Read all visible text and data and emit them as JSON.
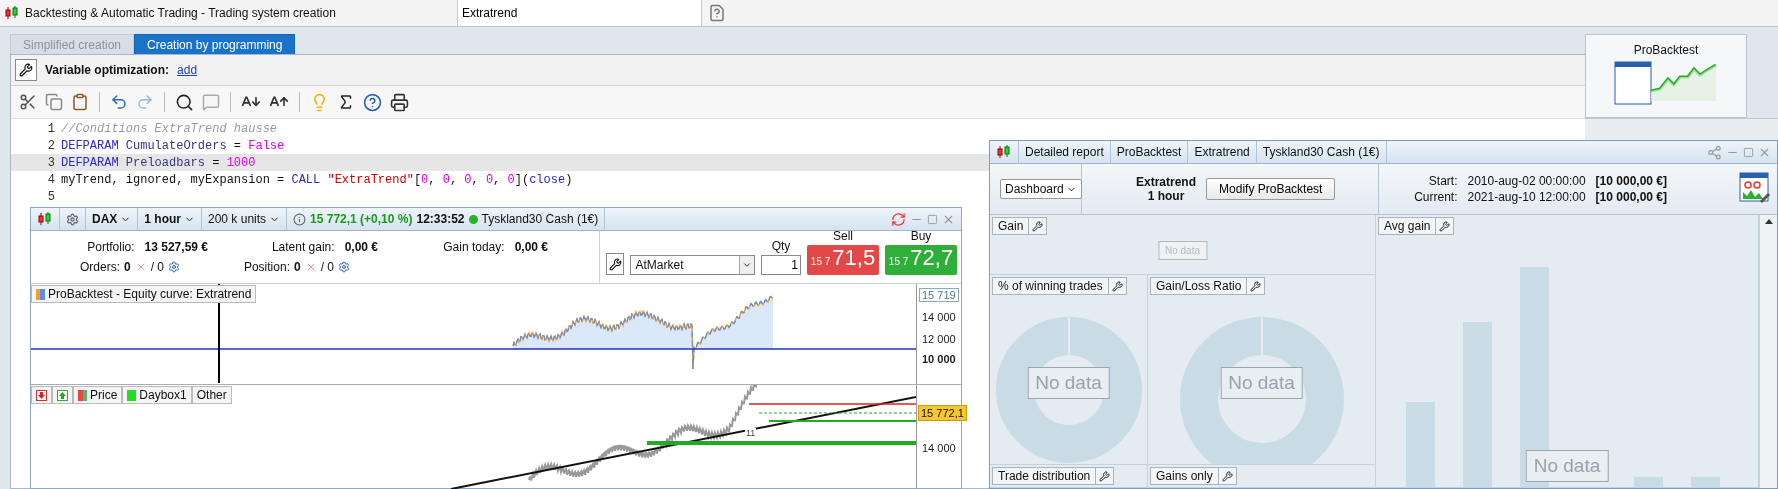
{
  "app_bar": {
    "title": "Backtesting & Automatic Trading - Trading system creation",
    "system_name": "Extratrend"
  },
  "tabs": [
    {
      "label": "Simplified creation",
      "selected": false
    },
    {
      "label": "Creation by programming",
      "selected": true
    }
  ],
  "variable_optimization": {
    "label": "Variable optimization:",
    "link": "add"
  },
  "editor": {
    "lines": [
      {
        "number": "1",
        "highlighted": false,
        "tokens": [
          {
            "kind": "comment",
            "text": "//Conditions ExtraTrend hausse"
          }
        ]
      },
      {
        "number": "2",
        "highlighted": false,
        "tokens": [
          {
            "kind": "keyword",
            "text": "DEFPARAM"
          },
          {
            "kind": "name",
            "text": " CumulateOrders"
          },
          {
            "kind": "plain",
            "text": " = "
          },
          {
            "kind": "value",
            "text": "False"
          }
        ]
      },
      {
        "number": "3",
        "highlighted": true,
        "tokens": [
          {
            "kind": "keyword",
            "text": "DEFPARAM"
          },
          {
            "kind": "name",
            "text": " Preloadbars"
          },
          {
            "kind": "plain",
            "text": " = "
          },
          {
            "kind": "value",
            "text": "1000"
          }
        ]
      },
      {
        "number": "4",
        "highlighted": false,
        "tokens": [
          {
            "kind": "plain",
            "text": "myTrend, ignored, myExpansion = "
          },
          {
            "kind": "keyword",
            "text": "CALL"
          },
          {
            "kind": "string",
            "text": " \"ExtraTrend\""
          },
          {
            "kind": "plain",
            "text": "["
          },
          {
            "kind": "value",
            "text": "0"
          },
          {
            "kind": "plain",
            "text": ", "
          },
          {
            "kind": "value",
            "text": "0"
          },
          {
            "kind": "plain",
            "text": ", "
          },
          {
            "kind": "value",
            "text": "0"
          },
          {
            "kind": "plain",
            "text": ", "
          },
          {
            "kind": "value",
            "text": "0"
          },
          {
            "kind": "plain",
            "text": ", "
          },
          {
            "kind": "value",
            "text": "0"
          },
          {
            "kind": "plain",
            "text": "]("
          },
          {
            "kind": "keyword",
            "text": "close"
          },
          {
            "kind": "plain",
            "text": ")"
          }
        ]
      },
      {
        "number": "5",
        "highlighted": false
      }
    ]
  },
  "side_panel": {
    "tile": "ProBacktest"
  },
  "trading_window": {
    "instrument": "DAX",
    "timeframe": "1 hour",
    "units": "200 k units",
    "price": "15 772,1 (+0,10 %)",
    "time": "12:33:52",
    "market": "Tyskland30 Cash (1€)",
    "stats": [
      {
        "label": "Portfolio:",
        "value": "13 527,59 €"
      },
      {
        "label": "Latent gain:",
        "value": "0,00 €"
      },
      {
        "label": "Gain today:",
        "value": "0,00 €"
      }
    ],
    "counts": [
      {
        "label": "Orders:",
        "value": "0",
        "total": "/ 0"
      },
      {
        "label": "Position:",
        "value": "0",
        "total": "/ 0"
      }
    ],
    "order": {
      "type": "AtMarket",
      "qty_label": "Qty",
      "qty": "1",
      "sides": [
        {
          "kind": "sell",
          "label": "Sell",
          "prefix": "15 7",
          "price": "71,5"
        },
        {
          "kind": "buy",
          "label": "Buy",
          "prefix": "15 7",
          "price": "72,7"
        }
      ]
    },
    "equity_pane": {
      "legend": "ProBacktest - Equity curve: Extratrend",
      "axis": [
        {
          "text": "15 719",
          "kind": "current"
        },
        {
          "text": "14 000",
          "kind": "tick"
        },
        {
          "text": "12 000",
          "kind": "tick"
        },
        {
          "text": "10 000",
          "kind": "major"
        }
      ]
    },
    "price_pane": {
      "legend": [
        {
          "label": "Price",
          "kind": "price"
        },
        {
          "label": "Daybox1",
          "kind": "series",
          "color": "#22dd22"
        },
        {
          "label": "Other",
          "kind": "plain"
        }
      ],
      "marker": "11",
      "axis": [
        {
          "text": "15 772,1",
          "kind": "current"
        },
        {
          "text": "14 000",
          "kind": "tick"
        }
      ]
    }
  },
  "report": {
    "header": [
      "Detailed report",
      "ProBacktest",
      "Extratrend",
      "Tyskland30 Cash (1€)"
    ],
    "view": "Dashboard",
    "system": "Extratrend",
    "timeframe": "1 hour",
    "button": "Modify ProBacktest",
    "periods": [
      {
        "label": "Start:",
        "date": "2010-aug-02 00:00:00",
        "amount": "[10 000,00 €]"
      },
      {
        "label": "Current:",
        "date": "2021-aug-10 12:00:00",
        "amount": "[10 000,00 €]"
      }
    ],
    "widgets": [
      {
        "title": "Gain",
        "kind": "small",
        "message": "No data"
      },
      {
        "title": "% of winning trades",
        "kind": "donut",
        "message": "No data"
      },
      {
        "title": "Gain/Loss Ratio",
        "kind": "donut",
        "message": "No data"
      },
      {
        "title": "Avg gain",
        "kind": "bars",
        "message": "No data"
      },
      {
        "title": "Trade distribution",
        "kind": "empty"
      },
      {
        "title": "Gains only",
        "kind": "empty"
      }
    ]
  }
}
